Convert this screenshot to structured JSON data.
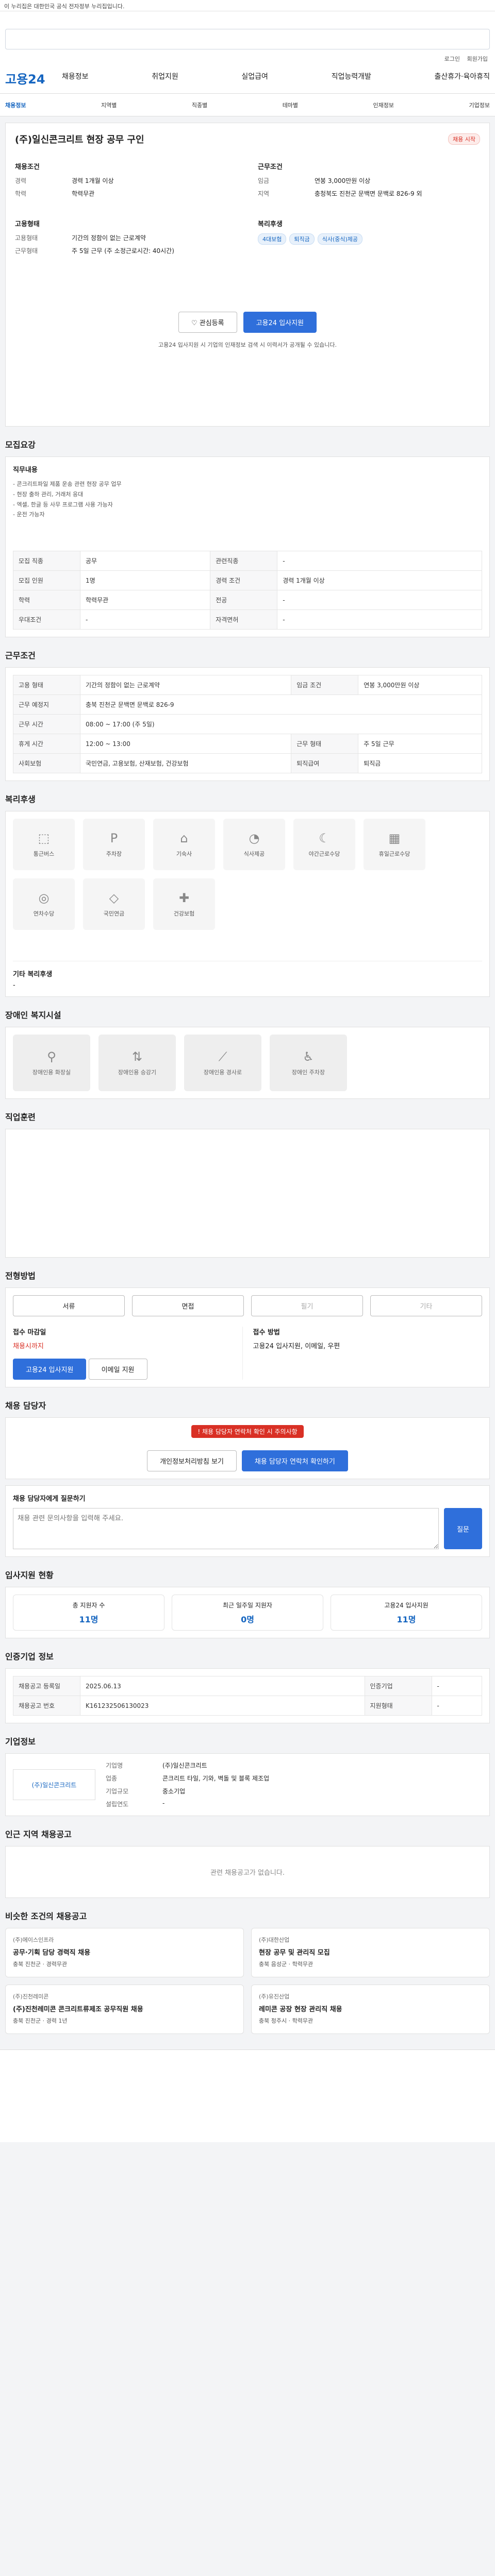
{
  "gov_banner": "이 누리집은 대한민국 공식 전자정부 누리집입니다.",
  "brand": "고용24",
  "top_links": [
    "로그인",
    "회원가입"
  ],
  "gnb": [
    "채용정보",
    "취업지원",
    "실업급여",
    "직업능력개발",
    "출산휴가·육아휴직"
  ],
  "subnav": [
    "채용정보",
    "지역별",
    "직종별",
    "테마별",
    "인재정보",
    "기업정보"
  ],
  "job": {
    "title": "(주)일신콘크리트 현장 공무 구인",
    "status": "채용 시작",
    "recruit_head": "채용조건",
    "recruit": [
      [
        "경력",
        "경력 1개월 이상"
      ],
      [
        "학력",
        "학력무관"
      ]
    ],
    "company_head": "근무조건",
    "company": [
      [
        "임금",
        "연봉 3,000만원 이상"
      ],
      [
        "지역",
        "충청북도 진천군 문백면 문백로 826-9 외"
      ]
    ],
    "work_head": "고용형태",
    "work": [
      [
        "고용형태",
        "기간의 정함이 없는 근로계약"
      ],
      [
        "근무형태",
        "주 5일 근무 (주 소정근로시간: 40시간)"
      ]
    ],
    "apply_head": "복리후생",
    "apply_tags": [
      "4대보험",
      "퇴직금",
      "식사(중식)제공"
    ],
    "scrap_btn": "관심등록",
    "apply_btn": "고용24 입사지원",
    "apply_note": "고용24 입사지원 시 기업의 인재정보 검색 시 이력서가 공개될 수 있습니다."
  },
  "sections": {
    "overview": "모집요강",
    "duty_label": "직무내용",
    "duty_lines": [
      "- 콘크리트파일 제품 운송 관련 현장 공무 업무",
      "- 현장 출하 관리, 거래처 응대",
      "- 엑셀, 한글 등 사무 프로그램 사용 가능자",
      "- 운전 가능자"
    ],
    "conditions": "근무조건",
    "welfare": "복리후생",
    "disability": "장애인 복지시설",
    "training": "직업훈련",
    "process": "전형방법",
    "manager": "채용 담당자",
    "stats": "입사지원 현황",
    "other": "인증기업 정보",
    "company": "기업정보",
    "same": "인근 지역 채용공고",
    "recommend": "비슷한 조건의 채용공고"
  },
  "overview_rows": [
    [
      "모집 직종",
      "공무",
      "관련직종",
      "-"
    ],
    [
      "모집 인원",
      "1명",
      "경력 조건",
      "경력 1개월 이상"
    ],
    [
      "학력",
      "학력무관",
      "전공",
      "-"
    ],
    [
      "우대조건",
      "-",
      "자격면허",
      "-"
    ]
  ],
  "cond_rows": [
    [
      "고용 형태",
      "기간의 정함이 없는 근로계약",
      "임금 조건",
      "연봉 3,000만원 이상"
    ],
    [
      "근무 예정지",
      "충북 진천군 문백면 문백로 826-9",
      "",
      ""
    ],
    [
      "근무 시간",
      "08:00 ~ 17:00 (주 5일)",
      "",
      ""
    ],
    [
      "휴게 시간",
      "12:00 ~ 13:00",
      "근무 형태",
      "주 5일 근무"
    ],
    [
      "사회보험",
      "국민연금, 고용보험, 산재보험, 건강보험",
      "퇴직급여",
      "퇴직금"
    ]
  ],
  "welfare_items": [
    "통근버스",
    "주차장",
    "기숙사",
    "식사제공",
    "야간근로수당",
    "휴일근로수당",
    "연차수당",
    "국민연금",
    "건강보험"
  ],
  "welfare_extra_label": "기타 복리후생",
  "welfare_extra": "-",
  "disability_items": [
    "장애인용 화장실",
    "장애인용 승강기",
    "장애인용 경사로",
    "장애인 주차장"
  ],
  "process_steps": [
    "서류",
    "면접",
    "필기",
    "기타"
  ],
  "process_info_label": "접수 마감일",
  "process_info": "채용시까지",
  "apply_method_label": "접수 방법",
  "apply_method": "고용24 입사지원, 이메일, 우편",
  "process_buttons": [
    "고용24 입사지원",
    "이메일 지원"
  ],
  "manager_warning": "채용 담당자 연락처 확인 시 주의사항",
  "manager_buttons": [
    "개인정보처리방침 보기",
    "채용 담당자 연락처 확인하기"
  ],
  "question_label": "채용 담당자에게 질문하기",
  "question_placeholder": "채용 관련 문의사항을 입력해 주세요.",
  "question_btn": "질문",
  "stats_items": [
    [
      "총 지원자 수",
      "11명"
    ],
    [
      "최근 일주일 지원자",
      "0명"
    ],
    [
      "고용24 입사지원",
      "11명"
    ]
  ],
  "cert_rows": [
    [
      "채용공고 등록일",
      "2025.06.13",
      "인증기업",
      "-"
    ],
    [
      "채용공고 번호",
      "K161232506130023",
      "지원형태",
      "-"
    ]
  ],
  "company_info": [
    [
      "기업명",
      "(주)일신콘크리트"
    ],
    [
      "업종",
      "콘크리트 타일, 기와, 벽돌 및 블록 제조업"
    ],
    [
      "기업규모",
      "중소기업"
    ],
    [
      "설립연도",
      "-"
    ]
  ],
  "company_logo": "(주)일신콘크리트",
  "same_empty": "관련 채용공고가 없습니다.",
  "recommend_items": [
    {
      "co": "(주)에이스인프라",
      "title": "공무·기획 담당 경력직 채용",
      "tags": [
        "충북 진천군",
        "경력무관"
      ]
    },
    {
      "co": "(주)대한산업",
      "title": "현장 공무 및 관리직 모집",
      "tags": [
        "충북 음성군",
        "학력무관"
      ]
    },
    {
      "co": "(주)진천레미콘",
      "title": "(주)진천레미콘 콘크리트류제조 공무직원 채용",
      "tags": [
        "충북 진천군",
        "경력 1년"
      ]
    },
    {
      "co": "(주)유진산업",
      "title": "레미콘 공장 현장 관리직 채용",
      "tags": [
        "충북 청주시",
        "학력무관"
      ]
    }
  ],
  "colors": {
    "accent": "#2f6fdb",
    "brand": "#1565c0",
    "warn": "#d93025"
  }
}
